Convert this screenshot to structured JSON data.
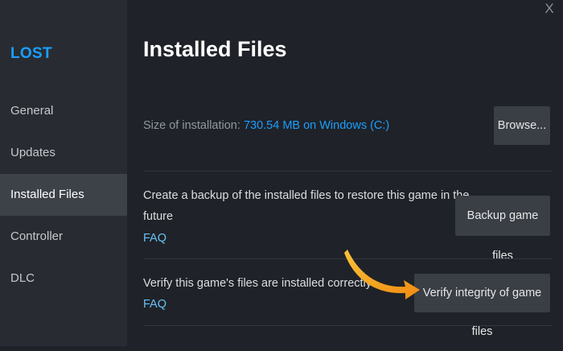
{
  "sidebar": {
    "game_title": "LOST",
    "items": [
      {
        "label": "General"
      },
      {
        "label": "Updates"
      },
      {
        "label": "Installed Files"
      },
      {
        "label": "Controller"
      },
      {
        "label": "DLC"
      }
    ]
  },
  "window": {
    "close_glyph": "X"
  },
  "main": {
    "title": "Installed Files",
    "size_label": "Size of installation:",
    "size_value": "730.54 MB on Windows (C:)",
    "browse_label": "Browse...",
    "backup_desc_line1": "Create a backup of the installed files to restore this game in the",
    "backup_desc_line2": "future",
    "backup_faq": "FAQ",
    "backup_button": "Backup game files",
    "verify_desc": "Verify this game's files are installed correctly",
    "verify_faq": "FAQ",
    "verify_button": "Verify integrity of game files"
  },
  "colors": {
    "accent": "#1a9fff",
    "link": "#67c1f5",
    "arrow": "#f7a21b"
  },
  "icons": [
    "close-icon",
    "pointer-arrow-icon"
  ]
}
